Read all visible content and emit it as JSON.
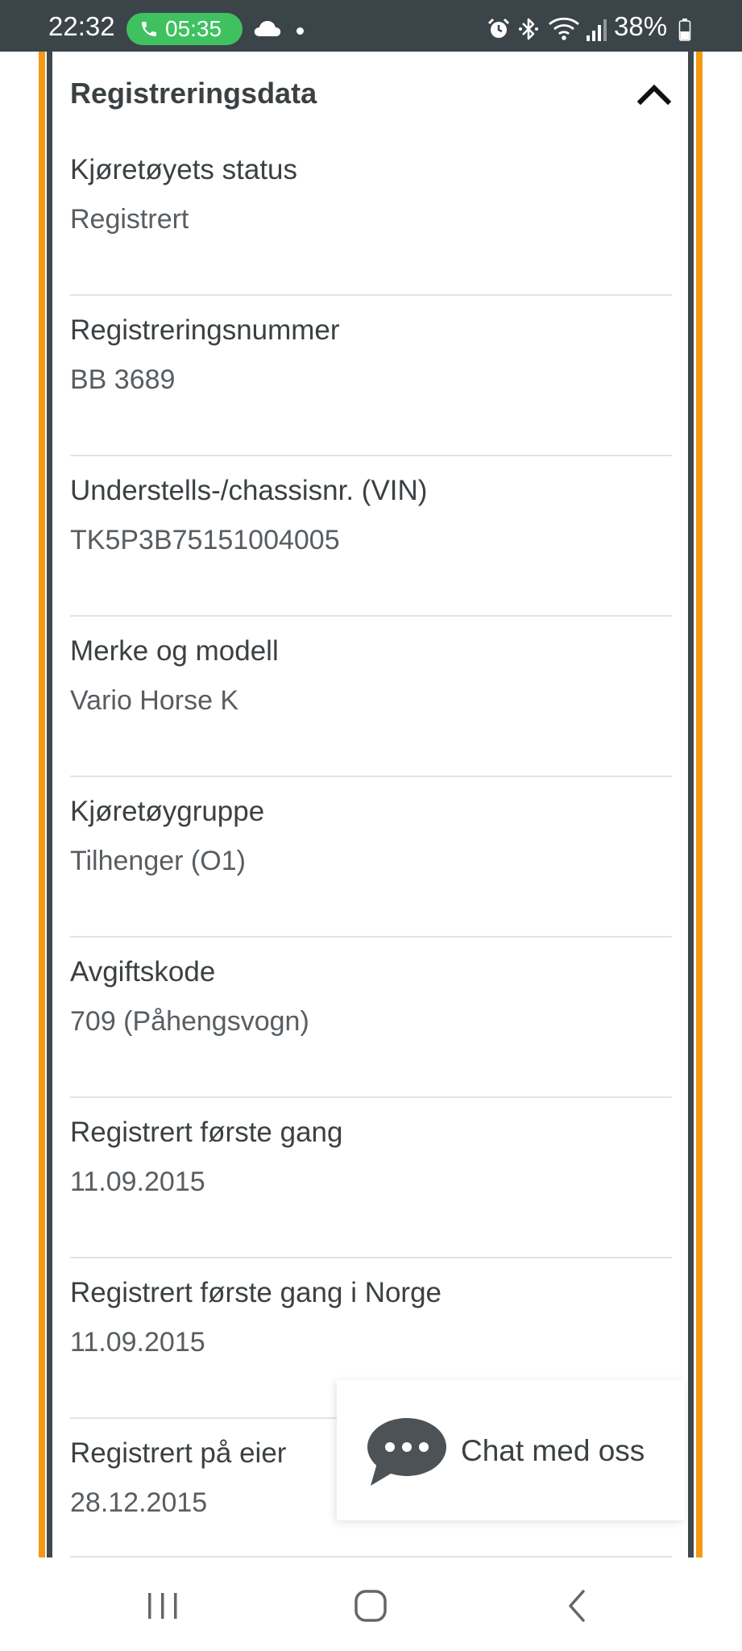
{
  "status_bar": {
    "time": "22:32",
    "call_time": "05:35",
    "battery": "38%"
  },
  "section": {
    "title": "Registreringsdata"
  },
  "fields": [
    {
      "label": "Kjøretøyets status",
      "value": "Registrert"
    },
    {
      "label": "Registreringsnummer",
      "value": "BB 3689"
    },
    {
      "label": "Understells-/chassisnr. (VIN)",
      "value": "TK5P3B75151004005"
    },
    {
      "label": "Merke og modell",
      "value": "Vario Horse K"
    },
    {
      "label": "Kjøretøygruppe",
      "value": "Tilhenger (O1)"
    },
    {
      "label": "Avgiftskode",
      "value": "709 (Påhengsvogn)"
    },
    {
      "label": "Registrert første gang",
      "value": "11.09.2015"
    },
    {
      "label": "Registrert første gang i Norge",
      "value": "11.09.2015"
    },
    {
      "label": "Registrert på eier",
      "value": "28.12.2015"
    }
  ],
  "chat": {
    "label": "Chat med oss"
  },
  "colors": {
    "accent_orange": "#f39a12",
    "frame_dark": "#3f484d",
    "call_green": "#3fc160"
  },
  "icons": {
    "collapse": "chevron-up-icon",
    "chat": "chat-bubble-icon",
    "nav_recent": "recent-apps-icon",
    "nav_home": "home-icon",
    "nav_back": "back-icon"
  }
}
